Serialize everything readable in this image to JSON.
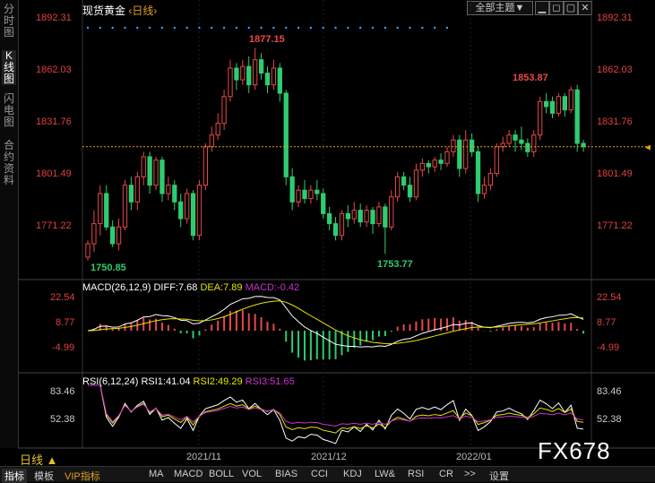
{
  "header": {
    "title": "现货黄金",
    "period": "日线",
    "theme_btn": "全部主题▼"
  },
  "side_nav": [
    {
      "label": "分时图",
      "active": false
    },
    {
      "label": "K线图",
      "active": true
    },
    {
      "label": "闪电图",
      "active": false
    },
    {
      "label": "合约资料",
      "active": false
    }
  ],
  "price_axis": [
    "1892.31",
    "1862.03",
    "1831.76",
    "1801.49",
    "1771.22"
  ],
  "annotations": {
    "high": "1877.15",
    "low_left": "1750.85",
    "low_mid": "1753.77",
    "recent_high": "1853.87"
  },
  "macd": {
    "label": "MACD(26,12,9)",
    "diff": "DIFF:7.68",
    "dea": "DEA:7.89",
    "macd": "MACD:-0.42",
    "axis": [
      "22.54",
      "8.77",
      "-4.99"
    ]
  },
  "rsi": {
    "label": "RSI(6,12,24)",
    "rsi1": "RSI1:41.04",
    "rsi2": "RSI2:49.29",
    "rsi3": "RSI3:51.65",
    "axis": [
      "83.46",
      "52.38"
    ]
  },
  "x_labels": [
    "2021/11",
    "2021/12",
    "2022/01"
  ],
  "period_btn": "日线 ▲",
  "bottom_tabs": [
    "指标",
    "模板",
    "VIP指标",
    "MA",
    "MACD",
    "BOLL",
    "VOL",
    "BIAS",
    "CCI",
    "KDJ",
    "LW&",
    "RSI",
    "CR",
    ">>",
    "设置"
  ],
  "watermark": "FX678",
  "colors": {
    "up": "#e84848",
    "down": "#2ecc71",
    "diff": "#ffffff",
    "dea": "#e6e600",
    "macd_up": "#e84848",
    "macd_down": "#2ecc71",
    "rsi1": "#ffffff",
    "rsi2": "#e6e600",
    "rsi3": "#cc33cc",
    "price_line": "#f0a000"
  },
  "chart_data": {
    "type": "candlestick",
    "ylim": [
      1745,
      1895
    ],
    "candles": [
      [
        1752,
        1760,
        1750,
        1762
      ],
      [
        1760,
        1772,
        1755,
        1780
      ],
      [
        1772,
        1790,
        1765,
        1795
      ],
      [
        1790,
        1770,
        1768,
        1795
      ],
      [
        1770,
        1760,
        1758,
        1774
      ],
      [
        1760,
        1770,
        1756,
        1775
      ],
      [
        1770,
        1795,
        1768,
        1798
      ],
      [
        1795,
        1785,
        1780,
        1800
      ],
      [
        1785,
        1800,
        1780,
        1803
      ],
      [
        1800,
        1812,
        1795,
        1815
      ],
      [
        1812,
        1795,
        1790,
        1815
      ],
      [
        1795,
        1810,
        1792,
        1812
      ],
      [
        1810,
        1790,
        1785,
        1812
      ],
      [
        1790,
        1795,
        1786,
        1800
      ],
      [
        1795,
        1785,
        1780,
        1798
      ],
      [
        1785,
        1775,
        1770,
        1790
      ],
      [
        1775,
        1790,
        1772,
        1793
      ],
      [
        1790,
        1765,
        1762,
        1792
      ],
      [
        1765,
        1795,
        1762,
        1798
      ],
      [
        1795,
        1818,
        1792,
        1820
      ],
      [
        1818,
        1825,
        1815,
        1830
      ],
      [
        1825,
        1832,
        1822,
        1838
      ],
      [
        1832,
        1848,
        1828,
        1852
      ],
      [
        1848,
        1865,
        1845,
        1870
      ],
      [
        1865,
        1858,
        1852,
        1868
      ],
      [
        1858,
        1866,
        1855,
        1870
      ],
      [
        1866,
        1855,
        1850,
        1872
      ],
      [
        1855,
        1870,
        1852,
        1877
      ],
      [
        1870,
        1862,
        1858,
        1874
      ],
      [
        1862,
        1855,
        1850,
        1866
      ],
      [
        1855,
        1865,
        1852,
        1870
      ],
      [
        1865,
        1850,
        1845,
        1868
      ],
      [
        1850,
        1800,
        1795,
        1852
      ],
      [
        1800,
        1785,
        1780,
        1805
      ],
      [
        1785,
        1792,
        1782,
        1795
      ],
      [
        1792,
        1787,
        1784,
        1798
      ],
      [
        1787,
        1792,
        1784,
        1795
      ],
      [
        1792,
        1790,
        1786,
        1798
      ],
      [
        1790,
        1778,
        1775,
        1793
      ],
      [
        1778,
        1772,
        1768,
        1782
      ],
      [
        1772,
        1765,
        1762,
        1776
      ],
      [
        1765,
        1778,
        1762,
        1780
      ],
      [
        1778,
        1775,
        1770,
        1783
      ],
      [
        1775,
        1780,
        1772,
        1785
      ],
      [
        1780,
        1773,
        1770,
        1784
      ],
      [
        1773,
        1780,
        1770,
        1783
      ],
      [
        1780,
        1772,
        1766,
        1782
      ],
      [
        1772,
        1782,
        1770,
        1785
      ],
      [
        1782,
        1770,
        1754,
        1784
      ],
      [
        1770,
        1788,
        1768,
        1792
      ],
      [
        1788,
        1800,
        1785,
        1803
      ],
      [
        1800,
        1795,
        1792,
        1803
      ],
      [
        1795,
        1788,
        1785,
        1800
      ],
      [
        1788,
        1804,
        1786,
        1808
      ],
      [
        1804,
        1808,
        1800,
        1811
      ],
      [
        1808,
        1806,
        1802,
        1810
      ],
      [
        1806,
        1810,
        1803,
        1812
      ],
      [
        1810,
        1808,
        1804,
        1814
      ],
      [
        1808,
        1815,
        1806,
        1818
      ],
      [
        1815,
        1822,
        1812,
        1825
      ],
      [
        1822,
        1805,
        1800,
        1825
      ],
      [
        1805,
        1822,
        1802,
        1828
      ],
      [
        1822,
        1815,
        1812,
        1826
      ],
      [
        1815,
        1790,
        1785,
        1818
      ],
      [
        1790,
        1795,
        1787,
        1800
      ],
      [
        1795,
        1802,
        1792,
        1805
      ],
      [
        1802,
        1818,
        1800,
        1820
      ],
      [
        1818,
        1820,
        1815,
        1824
      ],
      [
        1820,
        1825,
        1818,
        1828
      ],
      [
        1825,
        1822,
        1815,
        1828
      ],
      [
        1822,
        1820,
        1816,
        1830
      ],
      [
        1820,
        1815,
        1812,
        1823
      ],
      [
        1815,
        1825,
        1812,
        1828
      ],
      [
        1825,
        1845,
        1822,
        1848
      ],
      [
        1845,
        1842,
        1838,
        1850
      ],
      [
        1845,
        1838,
        1835,
        1848
      ],
      [
        1838,
        1848,
        1836,
        1850
      ],
      [
        1848,
        1840,
        1836,
        1850
      ],
      [
        1840,
        1852,
        1838,
        1854
      ],
      [
        1852,
        1820,
        1815,
        1855
      ],
      [
        1820,
        1818,
        1815,
        1822
      ]
    ]
  }
}
